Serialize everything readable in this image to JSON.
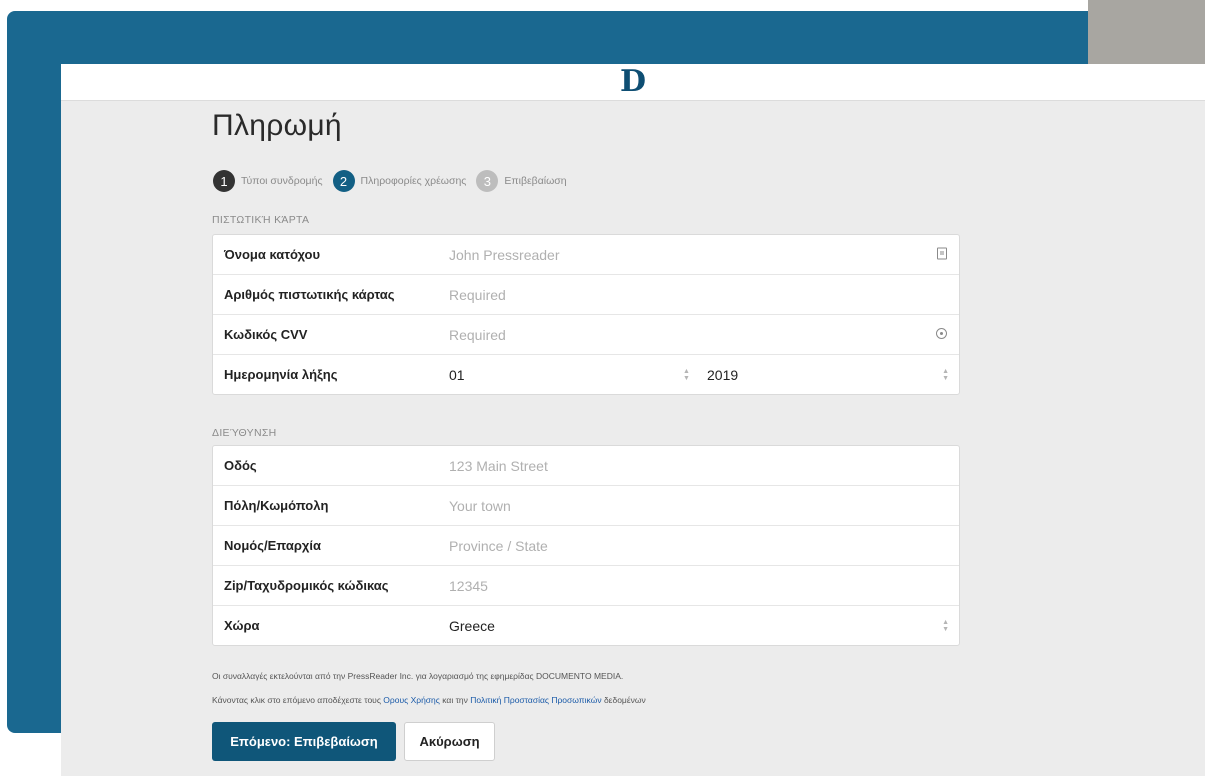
{
  "logo": "D",
  "page_title": "Πληρωμή",
  "steps": [
    {
      "num": "1",
      "label": "Τύποι συνδρομής",
      "state": "done"
    },
    {
      "num": "2",
      "label": "Πληροφορίες χρέωσης",
      "state": "active"
    },
    {
      "num": "3",
      "label": "Επιβεβαίωση",
      "state": "todo"
    }
  ],
  "credit_card": {
    "heading": "ΠΙΣΤΩΤΙΚΉ ΚΆΡΤΑ",
    "holder_label": "Όνομα κατόχου",
    "holder_placeholder": "John Pressreader",
    "number_label": "Αριθμός πιστωτικής κάρτας",
    "number_placeholder": "Required",
    "cvv_label": "Κωδικός CVV",
    "cvv_placeholder": "Required",
    "expiry_label": "Ημερομηνία λήξης",
    "expiry_month": "01",
    "expiry_year": "2019"
  },
  "address": {
    "heading": "ΔΙΕΎΘΥΝΣΗ",
    "street_label": "Οδός",
    "street_placeholder": "123 Main Street",
    "city_label": "Πόλη/Κωμόπολη",
    "city_placeholder": "Your town",
    "province_label": "Νομός/Επαρχία",
    "province_placeholder": "Province / State",
    "zip_label": "Zip/Ταχυδρομικός κώδικας",
    "zip_placeholder": "12345",
    "country_label": "Χώρα",
    "country_value": "Greece"
  },
  "notes": {
    "transactions": "Οι συναλλαγές εκτελούνται από την PressReader Inc. για λογαριασμό της εφημερίδας DOCUMENTO MEDIA.",
    "terms_prefix": "Κάνοντας κλικ στο επόμενο αποδέχεστε τους",
    "terms_link": "Ορους Χρήσης",
    "terms_middle": "και την",
    "privacy_link": "Πολιτική Προστασίας Προσωπικών",
    "terms_suffix": "δεδομένων"
  },
  "buttons": {
    "next": "Επόμενο: Επιβεβαίωση",
    "cancel": "Ακύρωση"
  },
  "colors": {
    "brand_blue": "#1a6890",
    "primary_button": "#0f5679",
    "active_step": "#125f84",
    "link": "#1a5aa8"
  }
}
